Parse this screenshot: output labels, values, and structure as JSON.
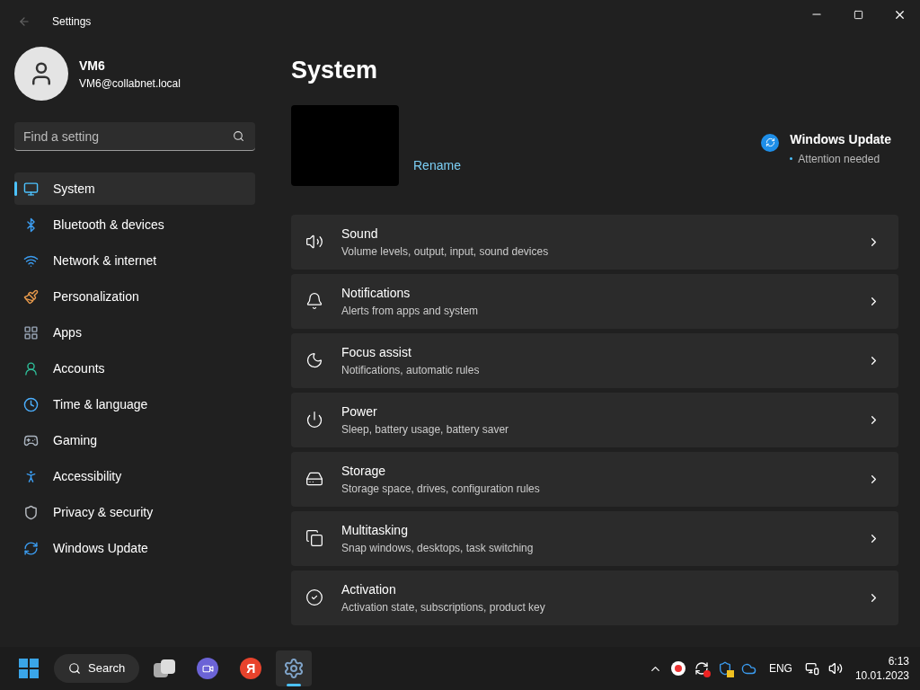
{
  "window": {
    "title": "Settings"
  },
  "user": {
    "name": "VM6",
    "email": "VM6@collabnet.local"
  },
  "search": {
    "placeholder": "Find a setting"
  },
  "sidebar": {
    "items": [
      {
        "label": "System",
        "selected": true
      },
      {
        "label": "Bluetooth & devices",
        "selected": false
      },
      {
        "label": "Network & internet",
        "selected": false
      },
      {
        "label": "Personalization",
        "selected": false
      },
      {
        "label": "Apps",
        "selected": false
      },
      {
        "label": "Accounts",
        "selected": false
      },
      {
        "label": "Time & language",
        "selected": false
      },
      {
        "label": "Gaming",
        "selected": false
      },
      {
        "label": "Accessibility",
        "selected": false
      },
      {
        "label": "Privacy & security",
        "selected": false
      },
      {
        "label": "Windows Update",
        "selected": false
      }
    ]
  },
  "page": {
    "title": "System",
    "rename": "Rename",
    "update": {
      "title": "Windows Update",
      "status": "Attention needed"
    }
  },
  "cards": [
    {
      "title": "Sound",
      "subtitle": "Volume levels, output, input, sound devices"
    },
    {
      "title": "Notifications",
      "subtitle": "Alerts from apps and system"
    },
    {
      "title": "Focus assist",
      "subtitle": "Notifications, automatic rules"
    },
    {
      "title": "Power",
      "subtitle": "Sleep, battery usage, battery saver"
    },
    {
      "title": "Storage",
      "subtitle": "Storage space, drives, configuration rules"
    },
    {
      "title": "Multitasking",
      "subtitle": "Snap windows, desktops, task switching"
    },
    {
      "title": "Activation",
      "subtitle": "Activation state, subscriptions, product key"
    }
  ],
  "taskbar": {
    "search": "Search",
    "yandex_letter": "Я",
    "apps": [
      {
        "kind": "taskview",
        "selected": false
      },
      {
        "kind": "meet",
        "selected": false
      },
      {
        "kind": "yandex",
        "selected": false
      },
      {
        "kind": "settings",
        "selected": true
      }
    ],
    "language": "ENG",
    "time": "6:13",
    "date": "10.01.2023"
  }
}
